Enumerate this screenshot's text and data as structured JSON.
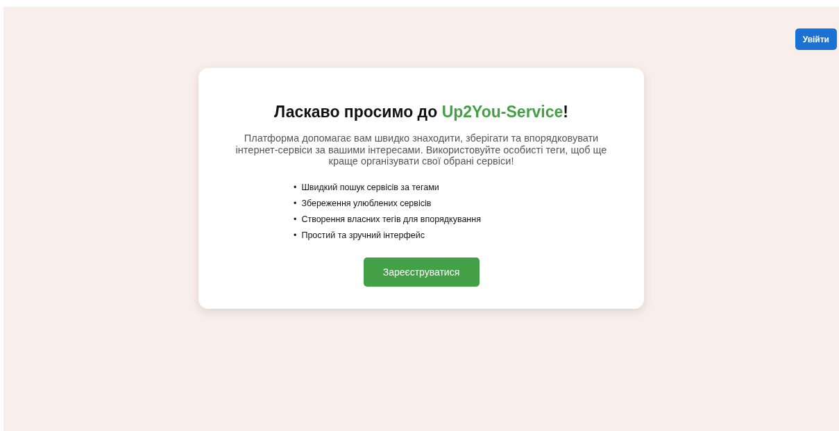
{
  "header": {
    "login_button": "Увійти"
  },
  "welcome_card": {
    "title": {
      "before": "Ласкаво просимо до ",
      "highlight": "Up2You-Service",
      "after": "!"
    },
    "description": "Платформа допомагає вам швидко знаходити, зберігати та впорядковувати інтернет-сервіси за вашими інтересами. Використовуйте особисті теги, щоб ще краще організувати свої обрані сервіси!",
    "features": [
      {
        "bullet": "•",
        "text": "Швидкий пошук сервісів за тегами"
      },
      {
        "bullet": "•",
        "text": "Збереження улюблених сервісів"
      },
      {
        "bullet": "•",
        "text": "Створення власних тегів для впорядкування"
      },
      {
        "bullet": "•",
        "text": "Простий та зручний інтерфейс"
      }
    ],
    "register_button": "Зареєструватися"
  }
}
